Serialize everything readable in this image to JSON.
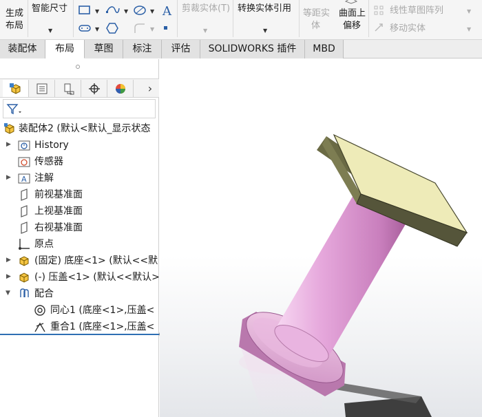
{
  "ribbon": {
    "generate_layout": [
      "生成",
      "布局"
    ],
    "smart_dimension": "智能尺寸",
    "trim_entities": "剪裁实体(T)",
    "convert_entities": "转换实体引用",
    "offset_entities": [
      "等距实",
      "体"
    ],
    "offset_on_surface": [
      "曲面上",
      "偏移"
    ],
    "linear_pattern": "线性草图阵列",
    "move_entities": "移动实体"
  },
  "tabs": [
    {
      "label": "装配体",
      "active": false
    },
    {
      "label": "布局",
      "active": true
    },
    {
      "label": "草图",
      "active": false
    },
    {
      "label": "标注",
      "active": false
    },
    {
      "label": "评估",
      "active": false
    },
    {
      "label": "SOLIDWORKS 插件",
      "active": false
    },
    {
      "label": "MBD",
      "active": false
    }
  ],
  "tree": {
    "root": "装配体2  (默认<默认_显示状态",
    "items": [
      "History",
      "传感器",
      "注解",
      "前视基准面",
      "上视基准面",
      "右视基准面",
      "原点",
      "(固定) 底座<1> (默认<<默",
      "(-) 压盖<1> (默认<<默认>",
      "配合",
      "同心1 (底座<1>,压盖<",
      "重合1 (底座<1>,压盖<"
    ]
  },
  "colors": {
    "plate_top": "#eeebb8",
    "plate_side": "#5a5a3c",
    "shaft_pink": "#e6a8dc",
    "selection_blue": "#2e6fb3"
  }
}
